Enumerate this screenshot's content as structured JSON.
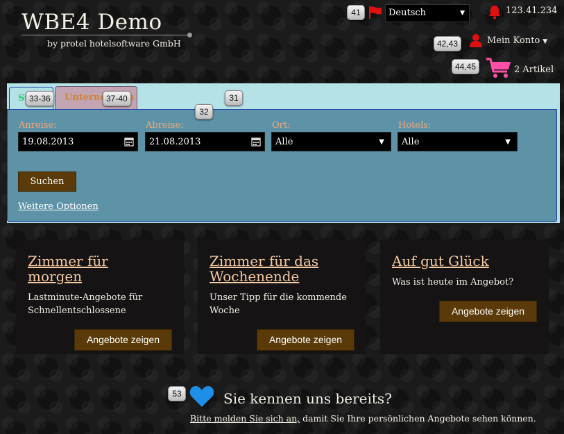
{
  "header": {
    "logo_title": "WBE4 Demo",
    "logo_sub": "by protel hotelsoftware GmbH",
    "language": "Deutsch",
    "ip": "123.41.234",
    "account": "Mein Konto",
    "cart": "2 Artikel"
  },
  "search": {
    "tab_search": "St",
    "tab_company": "Unternehmen",
    "arrival_label": "Anreise:",
    "arrival_value": "19.08.2013",
    "departure_label": "Abreise:",
    "departure_value": "21.08.2013",
    "place_label": "Ort:",
    "place_value": "Alle",
    "hotels_label": "Hotels:",
    "hotels_value": "Alle",
    "search_button": "Suchen",
    "more_options": "Weitere Optionen"
  },
  "cards": [
    {
      "title_line1": "Zimmer für",
      "title_line2": "morgen",
      "text_line1": "Lastminute-Angebote für",
      "text_line2": "Schnellentschlossene",
      "button": "Angebote zeigen"
    },
    {
      "title_line1": "Zimmer für das",
      "title_line2": "Wochenende",
      "text_line1": "Unser Tipp für die kommende",
      "text_line2": "Woche",
      "button": "Angebote zeigen"
    },
    {
      "title_line1": "Auf gut Glück",
      "text_line1": "Was ist heute im Angebot?",
      "button": "Angebote zeigen"
    }
  ],
  "bottom": {
    "heading": "Sie kennen uns bereits?",
    "login_link": "Bitte melden Sie sich an,",
    "login_rest": " damit Sie Ihre persönlichen Angebote sehen können."
  },
  "markers": {
    "m41": "41",
    "m4243": "42,43",
    "m4445": "44,45",
    "m3336": "33-36",
    "m3740": "37-40",
    "m31": "31",
    "m32": "32",
    "m53": "53"
  },
  "icons": {
    "flag": "flag-icon",
    "bell": "bell-icon",
    "user": "user-icon",
    "cart": "cart-icon",
    "calendar": "calendar-icon",
    "heart": "heart-icon"
  },
  "colors": {
    "panel_light": "#b5e2e6",
    "panel_body": "#5e92a6",
    "button_brown": "#5a3a08",
    "label_orange": "#f2a87c",
    "accent_red": "#e01010",
    "heart_blue": "#1f8ee6",
    "cart_pink": "#ff4fa8"
  }
}
